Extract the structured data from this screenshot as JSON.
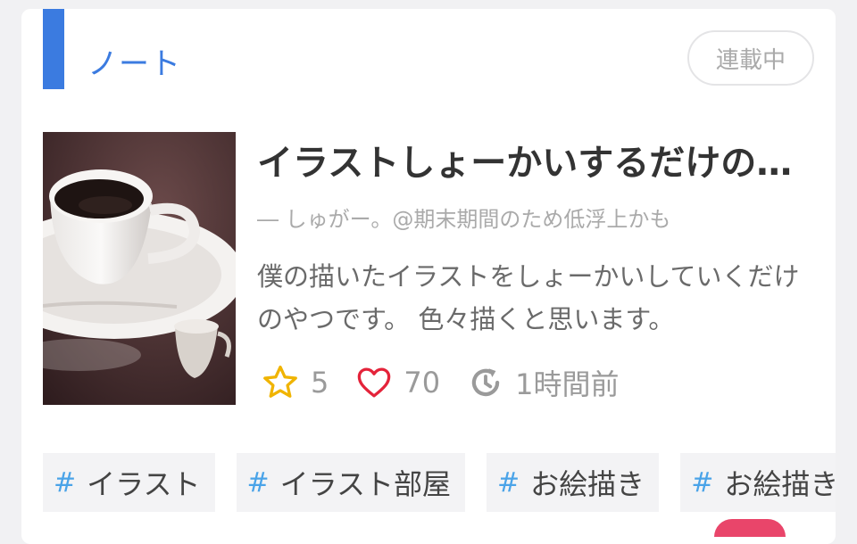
{
  "header": {
    "category_label": "ノート",
    "status_label": "連載中"
  },
  "item": {
    "title": "イラストしょーかいするだけのやつ",
    "author": "― しゅがー。@期末期間のため低浮上かも",
    "description": "僕の描いたイラストをしょーかいしていくだけのやつです。 色々描くと思います。",
    "thumbnail": "coffee-cup-photo",
    "stats": {
      "stars": "5",
      "likes": "70",
      "updated": "1時間前"
    }
  },
  "tags": [
    {
      "label": "イラスト"
    },
    {
      "label": "イラスト部屋"
    },
    {
      "label": "お絵描き"
    },
    {
      "label": "お絵描き"
    }
  ],
  "colors": {
    "accent": "#3b7be0",
    "star": "#f0b400",
    "heart": "#e4233a",
    "hash": "#4aa3e8"
  }
}
